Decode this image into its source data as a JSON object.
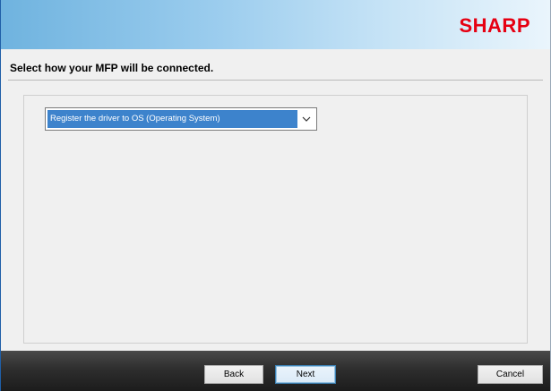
{
  "header": {
    "logo_text": "SHARP",
    "logo_color": "#e60012"
  },
  "main": {
    "heading": "Select how your MFP will be connected.",
    "connection_select": {
      "selected_value": "Register the driver to OS (Operating System)",
      "arrow_icon": "chevron-down-icon"
    }
  },
  "footer": {
    "back_label": "Back",
    "next_label": "Next",
    "cancel_label": "Cancel"
  },
  "colors": {
    "selection_highlight": "#3d83cc",
    "header_gradient_start": "#6fb3df",
    "footer_dark": "#2e2e2e"
  }
}
